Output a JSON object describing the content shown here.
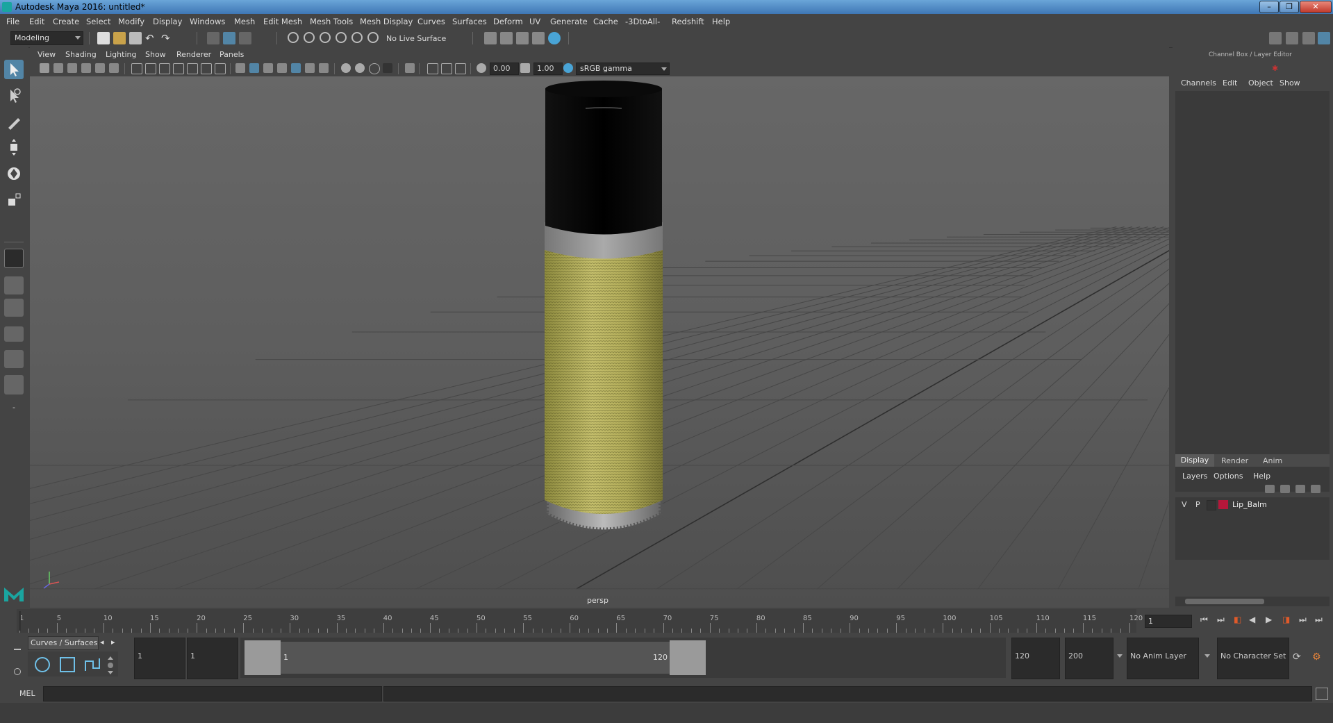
{
  "window": {
    "title": "Autodesk Maya 2016: untitled*"
  },
  "menu": [
    "File",
    "Edit",
    "Create",
    "Select",
    "Modify",
    "Display",
    "Windows",
    "Mesh",
    "Edit Mesh",
    "Mesh Tools",
    "Mesh Display",
    "Curves",
    "Surfaces",
    "Deform",
    "UV",
    "Generate",
    "Cache",
    "-3DtoAll-",
    "Redshift",
    "Help"
  ],
  "shelf": {
    "mode": "Modeling",
    "live_surface": "No Live Surface"
  },
  "viewport": {
    "menus": [
      "View",
      "Shading",
      "Lighting",
      "Show",
      "Renderer",
      "Panels"
    ],
    "exposure": "0.00",
    "gamma": "1.00",
    "colorspace": "sRGB gamma",
    "camera_label": "persp"
  },
  "right_panel": {
    "title": "Channel Box / Layer Editor",
    "channel_tabs": [
      "Channels",
      "Edit",
      "Object",
      "Show"
    ],
    "layer_tabs": [
      "Display",
      "Render",
      "Anim"
    ],
    "layer_menu": [
      "Layers",
      "Options",
      "Help"
    ],
    "layers": [
      {
        "v": "V",
        "p": "P",
        "color": "#b5173a",
        "name": "Lip_Balm"
      }
    ]
  },
  "timeline": {
    "ticks": [
      "1",
      "5",
      "10",
      "15",
      "20",
      "25",
      "30",
      "35",
      "40",
      "45",
      "50",
      "55",
      "60",
      "65",
      "70",
      "75",
      "80",
      "85",
      "90",
      "95",
      "100",
      "105",
      "110",
      "115",
      "120"
    ],
    "current_frame": "1"
  },
  "range": {
    "shelf_label": "Curves / Surfaces",
    "start": "1",
    "playback_start": "1",
    "slider_start": "1",
    "slider_end": "120",
    "playback_end": "120",
    "end": "200",
    "anim_layer": "No Anim Layer",
    "character_set": "No Character Set"
  },
  "cmd": {
    "label": "MEL"
  },
  "colors": {
    "accent": "#5285a6",
    "background": "#444444",
    "viewport": "#606060",
    "layer_color": "#b5173a"
  }
}
